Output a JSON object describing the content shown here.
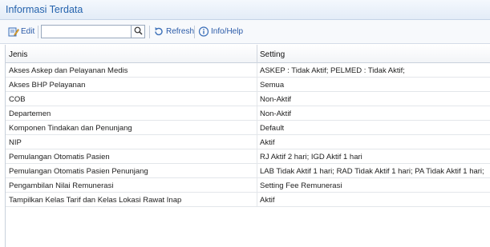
{
  "panel": {
    "title": "Informasi Terdata"
  },
  "toolbar": {
    "edit_label": "Edit",
    "search_value": "",
    "search_placeholder": "",
    "refresh_label": "Refresh",
    "info_label": "Info/Help"
  },
  "grid": {
    "columns": [
      "Jenis",
      "Setting"
    ],
    "rows": [
      [
        "Akses Askep dan Pelayanan Medis",
        "ASKEP : Tidak Aktif; PELMED : Tidak Aktif;"
      ],
      [
        "Akses BHP Pelayanan",
        "Semua"
      ],
      [
        "COB",
        "Non-Aktif"
      ],
      [
        "Departemen",
        "Non-Aktif"
      ],
      [
        "Komponen Tindakan dan Penunjang",
        "Default"
      ],
      [
        "NIP",
        "Aktif"
      ],
      [
        "Pemulangan Otomatis Pasien",
        "RJ Aktif 2 hari; IGD Aktif 1 hari"
      ],
      [
        "Pemulangan Otomatis Pasien Penunjang",
        "LAB Tidak Aktif 1 hari; RAD Tidak Aktif 1 hari; PA Tidak Aktif 1 hari;"
      ],
      [
        "Pengambilan Nilai Remunerasi",
        "Setting Fee Remunerasi"
      ],
      [
        "Tampilkan Kelas Tarif dan Kelas Lokasi Rawat Inap",
        "Aktif"
      ]
    ]
  },
  "colors": {
    "accent": "#2563ad",
    "link": "#2a5aa8"
  },
  "icons": [
    "edit-icon",
    "search-icon",
    "refresh-icon",
    "info-icon"
  ]
}
